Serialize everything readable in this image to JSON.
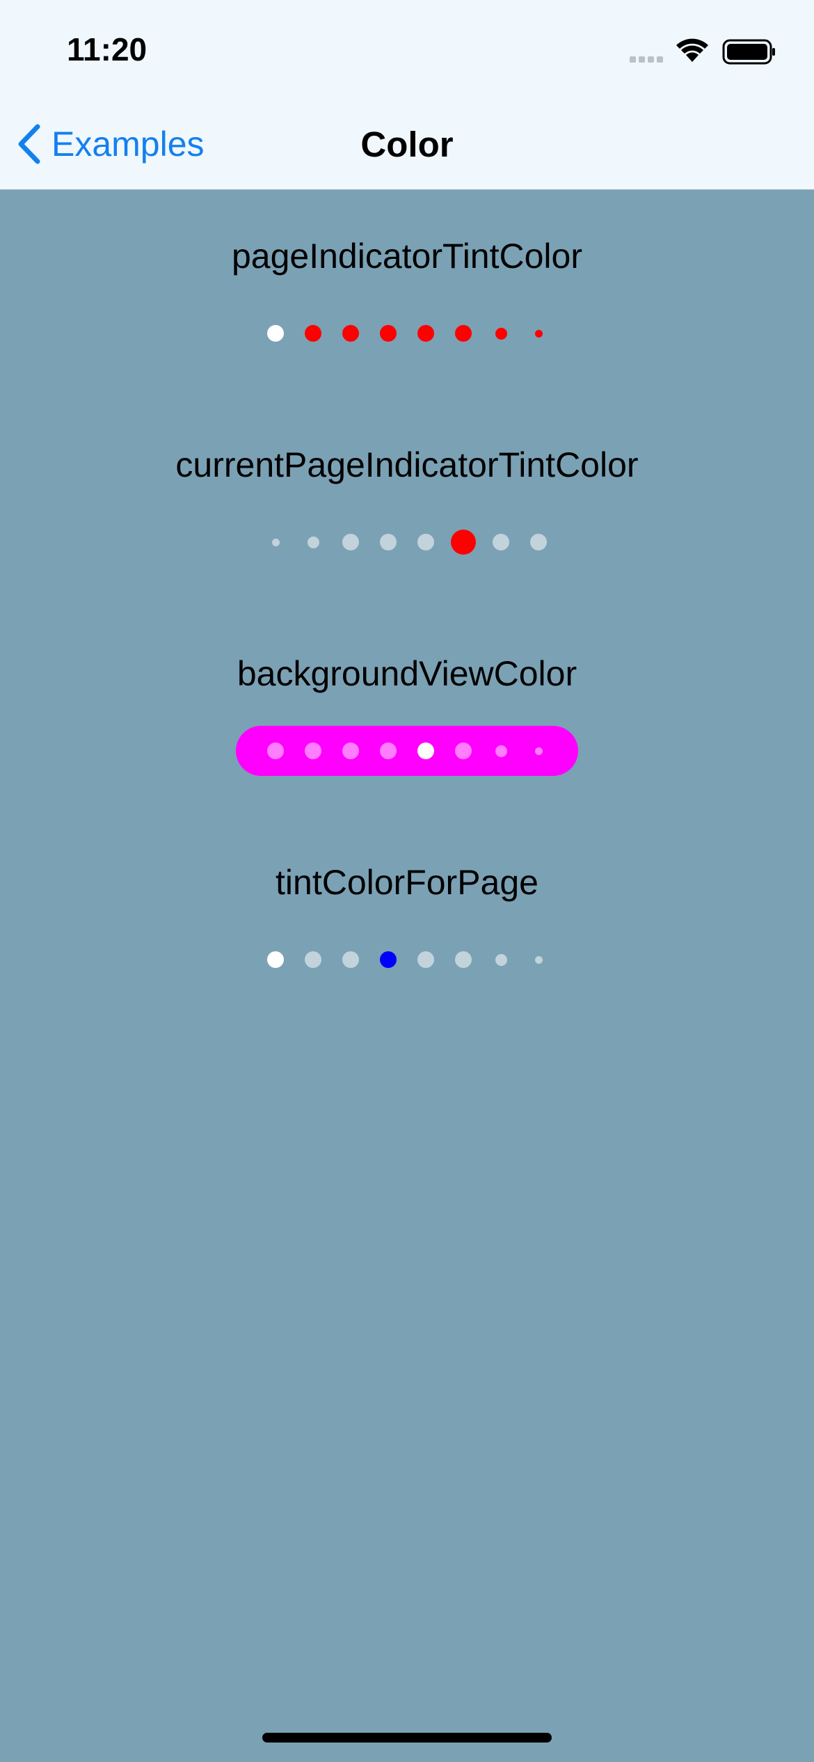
{
  "status_bar": {
    "time": "11:20",
    "icons": [
      "cellular-signal-icon",
      "wifi-icon",
      "battery-icon"
    ]
  },
  "nav": {
    "back_label": "Examples",
    "back_icon": "chevron-left-icon",
    "title": "Color"
  },
  "colors": {
    "accent": "#1380ee",
    "background": "#7ba1b4",
    "bar_background": "#f0f8fd",
    "red": "#ff0000",
    "magenta": "#ff00ff",
    "blue": "#0000ff",
    "white": "#ffffff",
    "inactive_dot": "#c2d3dc"
  },
  "sections": [
    {
      "label": "pageIndicatorTintColor",
      "page_count": 8,
      "current_page": 1,
      "background": "",
      "dots": [
        {
          "color": "#ffffff",
          "scale": "large"
        },
        {
          "color": "#ff0000",
          "scale": "large"
        },
        {
          "color": "#ff0000",
          "scale": "large"
        },
        {
          "color": "#ff0000",
          "scale": "large"
        },
        {
          "color": "#ff0000",
          "scale": "large"
        },
        {
          "color": "#ff0000",
          "scale": "large"
        },
        {
          "color": "#ff0000",
          "scale": "medium"
        },
        {
          "color": "#ff0000",
          "scale": "small"
        }
      ]
    },
    {
      "label": "currentPageIndicatorTintColor",
      "page_count": 8,
      "current_page": 6,
      "background": "",
      "dots": [
        {
          "color": "#c2d3dc",
          "scale": "small"
        },
        {
          "color": "#c2d3dc",
          "scale": "medium"
        },
        {
          "color": "#c2d3dc",
          "scale": "large"
        },
        {
          "color": "#c2d3dc",
          "scale": "large"
        },
        {
          "color": "#c2d3dc",
          "scale": "large"
        },
        {
          "color": "#ff0000",
          "scale": "xlarge"
        },
        {
          "color": "#c2d3dc",
          "scale": "large"
        },
        {
          "color": "#c2d3dc",
          "scale": "large"
        }
      ]
    },
    {
      "label": "backgroundViewColor",
      "page_count": 8,
      "current_page": 5,
      "background": "#ff00ff",
      "dots": [
        {
          "color": "#ff7dff",
          "scale": "large"
        },
        {
          "color": "#ff7dff",
          "scale": "large"
        },
        {
          "color": "#ff7dff",
          "scale": "large"
        },
        {
          "color": "#ff7dff",
          "scale": "large"
        },
        {
          "color": "#ffffff",
          "scale": "large"
        },
        {
          "color": "#ff7dff",
          "scale": "large"
        },
        {
          "color": "#ff7dff",
          "scale": "medium"
        },
        {
          "color": "#ff7dff",
          "scale": "small"
        }
      ]
    },
    {
      "label": "tintColorForPage",
      "page_count": 8,
      "current_page": 1,
      "background": "",
      "dots": [
        {
          "color": "#ffffff",
          "scale": "large"
        },
        {
          "color": "#c2d3dc",
          "scale": "large"
        },
        {
          "color": "#c2d3dc",
          "scale": "large"
        },
        {
          "color": "#0000ff",
          "scale": "large"
        },
        {
          "color": "#c2d3dc",
          "scale": "large"
        },
        {
          "color": "#c2d3dc",
          "scale": "large"
        },
        {
          "color": "#c2d3dc",
          "scale": "medium"
        },
        {
          "color": "#c2d3dc",
          "scale": "small"
        }
      ]
    }
  ]
}
